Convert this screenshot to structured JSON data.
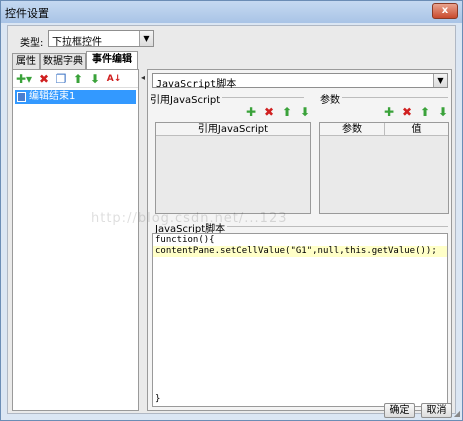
{
  "window": {
    "title": "控件设置",
    "close_glyph": "x"
  },
  "type_field": {
    "label": "类型:",
    "value": "下拉框控件",
    "arrow_glyph": "▼"
  },
  "tabs": [
    {
      "label": "属性"
    },
    {
      "label": "数据字典"
    },
    {
      "label": "事件编辑",
      "active": true
    }
  ],
  "left_toolbar": {
    "add_glyph": "✚▾",
    "delete_glyph": "✖",
    "copy_glyph": "❐",
    "up_glyph": "⬆",
    "down_glyph": "⬇",
    "sort_glyph": "A↓"
  },
  "events": [
    {
      "label": "编辑结束1",
      "selected": true
    }
  ],
  "splitter_glyph": "◂",
  "script_type": {
    "value": "JavaScript脚本",
    "arrow_glyph": "▼"
  },
  "ref_js": {
    "section_label": "引用JavaScript",
    "column": "引用JavaScript",
    "add_glyph": "✚",
    "delete_glyph": "✖",
    "up_glyph": "⬆",
    "down_glyph": "⬇"
  },
  "params": {
    "section_label": "参数",
    "columns": [
      "参数",
      "值"
    ],
    "add_glyph": "✚",
    "delete_glyph": "✖",
    "up_glyph": "⬆",
    "down_glyph": "⬇"
  },
  "script": {
    "section_label": "JavaScript脚本",
    "lines": [
      "function(){",
      "contentPane.setCellValue(\"G1\",null,this.getValue());",
      "}"
    ]
  },
  "buttons": {
    "ok": "确定",
    "cancel": "取消"
  },
  "watermark": "http://blog.csdn.net/...123",
  "colors": {
    "selection": "#3399ff",
    "code_highlight": "#ffffc8",
    "add_icon": "#3aa23a",
    "delete_icon": "#d02020"
  }
}
